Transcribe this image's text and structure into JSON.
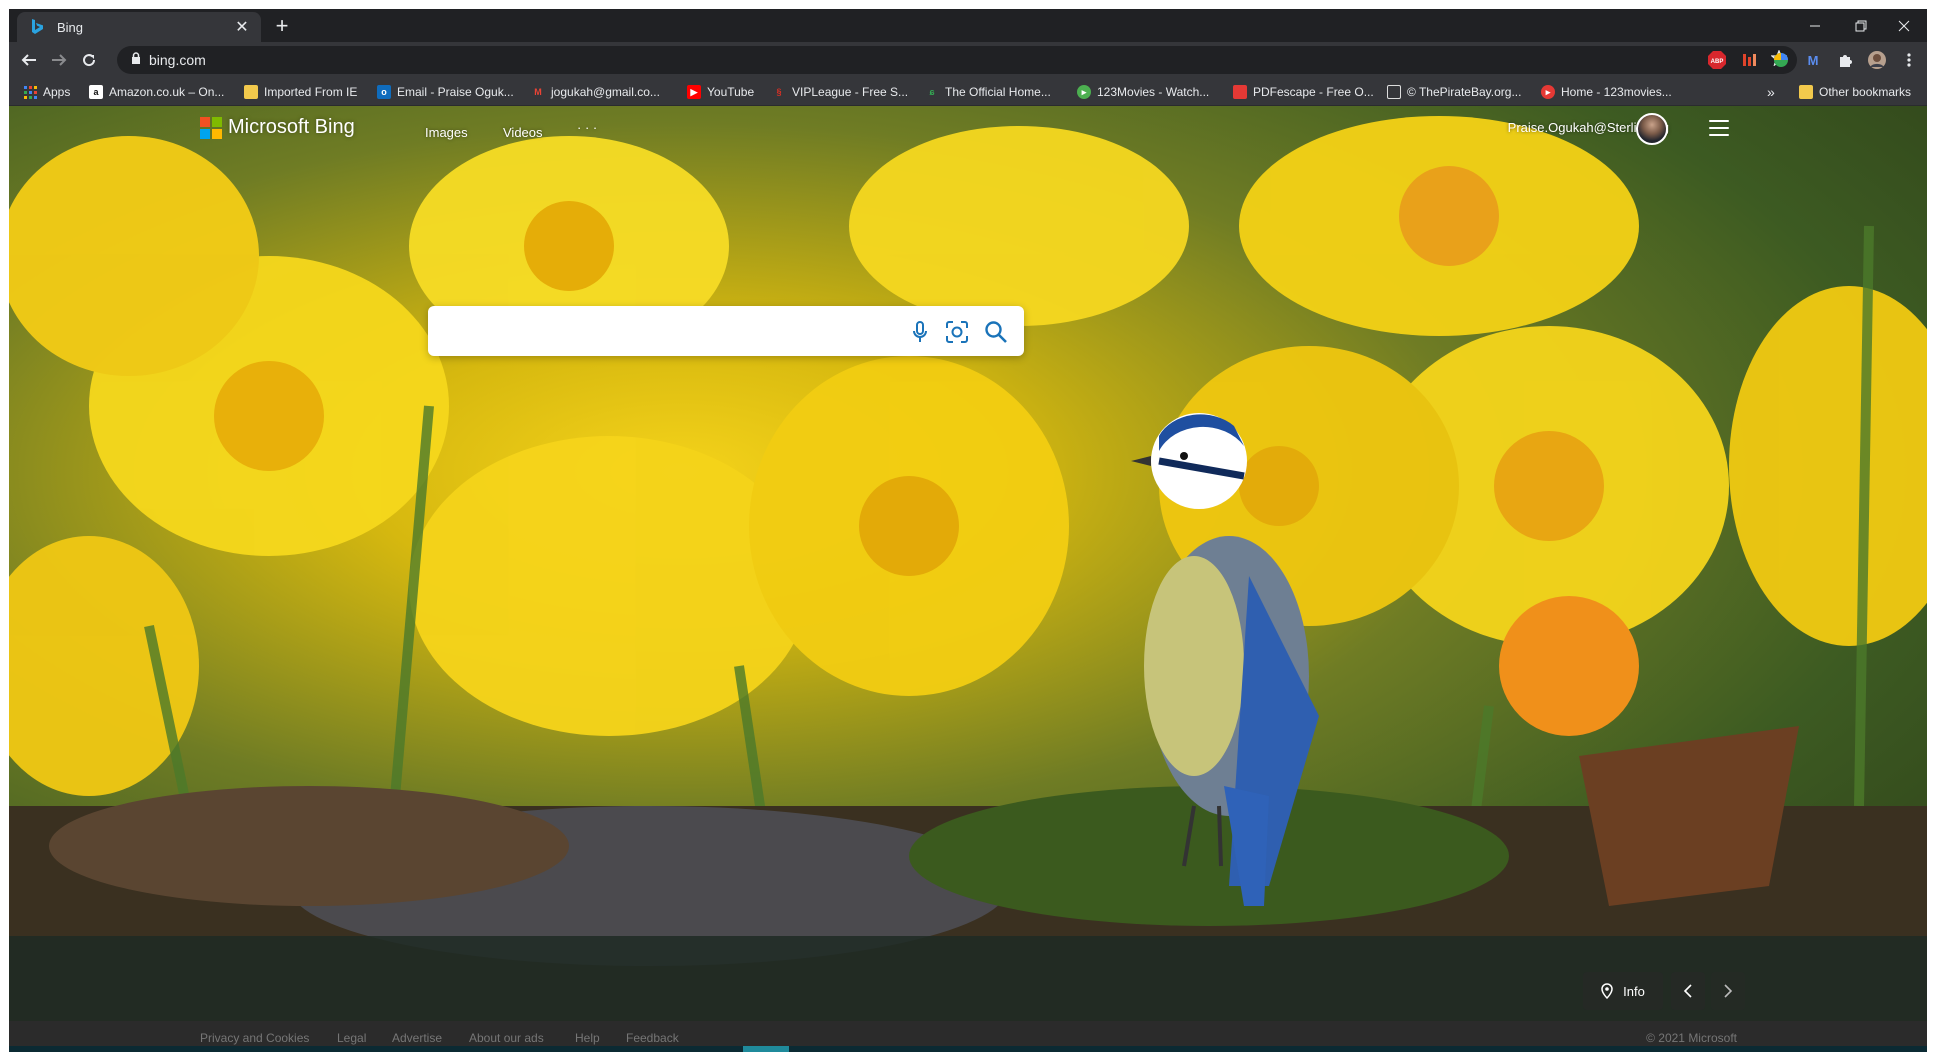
{
  "browser": {
    "tab_title": "Bing",
    "new_tab_symbol": "+",
    "url": "bing.com",
    "bookmarks": [
      {
        "label": "Apps",
        "icon": "apps-grid-icon",
        "color": "#4285f4"
      },
      {
        "label": "Amazon.co.uk – On...",
        "icon": "amazon-icon",
        "color": "#ffffff"
      },
      {
        "label": "Imported From IE",
        "icon": "folder-icon",
        "color": "#f2c94c"
      },
      {
        "label": "Email - Praise Oguk...",
        "icon": "outlook-icon",
        "color": "#0f6cbd"
      },
      {
        "label": "jogukah@gmail.co...",
        "icon": "gmail-icon",
        "color": "#ea4335"
      },
      {
        "label": "YouTube",
        "icon": "youtube-icon",
        "color": "#ff0000"
      },
      {
        "label": "VIPLeague - Free S...",
        "icon": "vipleague-icon",
        "color": "#d93025"
      },
      {
        "label": "The Official Home...",
        "icon": "leaf-icon",
        "color": "#34a853"
      },
      {
        "label": "123Movies - Watch...",
        "icon": "play-icon",
        "color": "#4caf50"
      },
      {
        "label": "PDFescape - Free O...",
        "icon": "pdf-icon",
        "color": "#e53935"
      },
      {
        "label": "© ThePirateBay.org...",
        "icon": "monitor-icon",
        "color": "#dddddd"
      },
      {
        "label": "Home - 123movies...",
        "icon": "play-red-icon",
        "color": "#e53935"
      }
    ],
    "overflow_label": "»",
    "other_bookmarks": "Other bookmarks",
    "extensions": [
      "abp-icon",
      "ext-red-icon",
      "ext-multicolor-icon",
      "ext-blue-m-icon",
      "puzzle-icon",
      "profile-avatar-icon"
    ]
  },
  "bing": {
    "logo_text": "Microsoft Bing",
    "nav": [
      "Images",
      "Videos",
      "· · ·"
    ],
    "user_email": "Praise.Ogukah@Sterling.ng",
    "info_label": "Info",
    "footer_links": [
      "Privacy and Cookies",
      "Legal",
      "Advertise",
      "About our ads",
      "Help",
      "Feedback"
    ],
    "copyright": "© 2021 Microsoft"
  },
  "colors": {
    "bing_blue": "#1a73b9",
    "chrome_dark": "#202124",
    "chrome_toolbar": "#35363a"
  }
}
